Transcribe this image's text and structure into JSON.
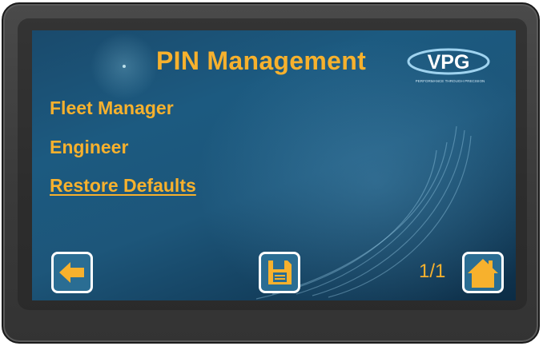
{
  "header": {
    "title": "PIN Management",
    "logo_text": "VPG",
    "logo_tagline": "PERFORMANCE THROUGH PRECISION"
  },
  "menu": {
    "items": [
      {
        "label": "Fleet Manager"
      },
      {
        "label": "Engineer"
      },
      {
        "label": "Restore Defaults"
      }
    ]
  },
  "footer": {
    "page_indicator": "1/1",
    "back_icon": "arrow-left-icon",
    "save_icon": "floppy-disk-icon",
    "home_icon": "home-icon"
  },
  "colors": {
    "accent": "#f7b12d",
    "screen_bg": "#1c5a80",
    "button_border": "#ffffff"
  }
}
